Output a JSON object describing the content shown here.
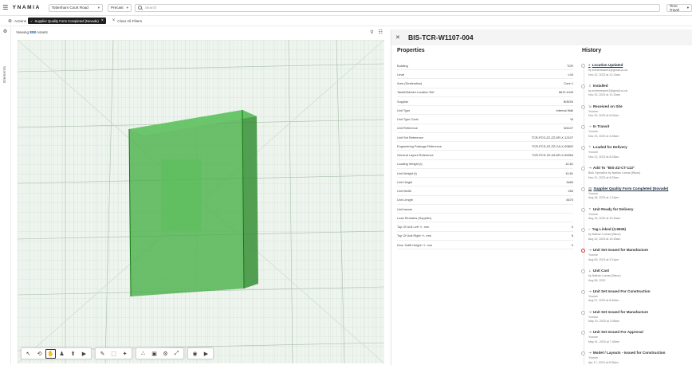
{
  "app": {
    "logo": "YNAMIA"
  },
  "topbar": {
    "project": "Tottenham Court Road",
    "category": "Precast",
    "search_placeholder": "Search",
    "time_button": "Time Travel"
  },
  "filterbar": {
    "actions_label": "Actions",
    "chip_label": "Supplier Quality Form Completed (Novade)",
    "clear_label": "Clear All Filters"
  },
  "rail": {
    "vertical_label": "Elements"
  },
  "viewer": {
    "viewing_prefix": "Viewing",
    "viewing_count": "808",
    "viewing_suffix": "Assets"
  },
  "panel": {
    "title": "BIS-TCR-W1107-004",
    "properties_heading": "Properties",
    "history_heading": "History",
    "properties": [
      {
        "label": "Building",
        "value": "TCR"
      },
      {
        "label": "Level",
        "value": "L04"
      },
      {
        "label": "Area (Destination)",
        "value": "Core 1"
      },
      {
        "label": "TaskID/Model Location Ref",
        "value": "MLR-1049"
      },
      {
        "label": "Supplier",
        "value": "BISON"
      },
      {
        "label": "Unit Type",
        "value": "Internal Wall"
      },
      {
        "label": "Unit Type Code",
        "value": "W"
      },
      {
        "label": "Unit Reference",
        "value": "W1107"
      },
      {
        "label": "Unit Set Reference",
        "value": "TCR-PCS-ZZ-ZZ-DR-X-12107"
      },
      {
        "label": "Engineering Package Reference",
        "value": "TCR-PCS-ZZ-ZZ-CA-X-00802"
      },
      {
        "label": "General Layout Reference",
        "value": "TCR-PCS-ZZ-04-DR-X-00054"
      },
      {
        "label": "Loading Weight (t)",
        "value": "10.81"
      },
      {
        "label": "Unit Weight (t)",
        "value": "10.81"
      },
      {
        "label": "Unit Height",
        "value": "3480"
      },
      {
        "label": "Unit Width",
        "value": "250"
      },
      {
        "label": "Unit Length",
        "value": "8470"
      },
      {
        "label": "Unit Issues",
        "value": ""
      },
      {
        "label": "Load Remarks (Supplier)",
        "value": ""
      },
      {
        "label": "Top Of Unit Left +/- mm",
        "value": "0"
      },
      {
        "label": "Top Of Unit Right +/- mm",
        "value": "5"
      },
      {
        "label": "Door Soffit Height +/- mm",
        "value": "0"
      }
    ],
    "history": [
      {
        "title": "Location Updated",
        "lines": [
          "by kmhenessert1@gmail.co.uk",
          "Nov 23, 2023 at 11:13am"
        ],
        "link": true
      },
      {
        "title": "Installed",
        "lines": [
          "by kmhenessert1@gmail.co.uk",
          "Nov 23, 2023 at 11:13am"
        ]
      },
      {
        "title": "Received on Site",
        "lines": [
          "Yvonne",
          "Nov 23, 2023 at 8:02am"
        ]
      },
      {
        "title": "In Transit",
        "lines": [
          "Yvonne",
          "Nov 23, 2023 at 4:28am"
        ]
      },
      {
        "title": "Loaded for Delivery",
        "lines": [
          "Yvonne",
          "Nov 21, 2023 at 8:33am"
        ]
      },
      {
        "title": "Add To \"BIS-ZZ-CT-113\"",
        "lines": [
          "Bulk Operation by Nathan Lomas (Bison)",
          "Nov 21, 2023 at 8:33am"
        ]
      },
      {
        "title": "Supplier Quality Form Completed (Novade)",
        "lines": [
          "Yvonne",
          "Aug 18, 2023 at 1:13pm"
        ],
        "link": true
      },
      {
        "title": "Unit Ready for Delivery",
        "lines": [
          "Yvonne",
          "Aug 10, 2023 at 10:43am"
        ]
      },
      {
        "title": "Tag Linked (3.9936)",
        "lines": [
          "by Nathan Lomas (Bison)",
          "Aug 10, 2023 at 10:43am"
        ]
      },
      {
        "title": "Unit Set Issued for Manufacture",
        "lines": [
          "Yvonne",
          "Aug 09, 2023 at 3:11pm"
        ],
        "red": true
      },
      {
        "title": "Unit Cast",
        "lines": [
          "by Nathan Lomas (Bison)",
          "Aug 08, 2023"
        ]
      },
      {
        "title": "Unit Set Issued For Construction",
        "lines": [
          "Yvonne",
          "Aug 07, 2023 at 8:45am"
        ]
      },
      {
        "title": "Unit Set Issued for Manufacture",
        "lines": [
          "Yvonne",
          "May 10, 2023 at 3:45am"
        ]
      },
      {
        "title": "Unit Set Issued For Approval",
        "lines": [
          "Yvonne",
          "May 01, 2023 at 7:45am"
        ]
      },
      {
        "title": "Model / Layouts - Issued for Construction",
        "lines": [
          "Yvonne",
          "Apr 17, 2023 at 8:35am"
        ]
      }
    ]
  },
  "colors": {
    "accent": "#1a5fb4",
    "highlight": "#1aa01a",
    "wireframe": "#9fb79f"
  }
}
